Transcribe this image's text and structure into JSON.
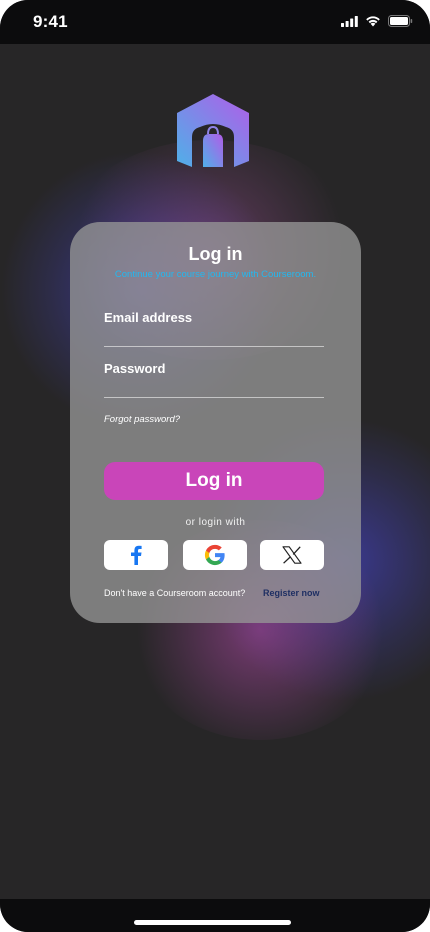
{
  "status_bar": {
    "time": "9:41",
    "icons": [
      "signal-icon",
      "wifi-icon",
      "battery-icon"
    ]
  },
  "logo": {
    "icon": "courseroom-logo-icon",
    "colors": [
      "#4fb0e8",
      "#b15de8"
    ]
  },
  "login_card": {
    "title": "Log in",
    "subtitle": "Continue your course journey with Courseroom.",
    "email_placeholder": "Email address",
    "password_placeholder": "Password",
    "forgot_password": "Forgot password?",
    "login_button": "Log in",
    "or_login_with": "or login with",
    "social_buttons": [
      {
        "name": "facebook",
        "icon": "facebook-icon"
      },
      {
        "name": "google",
        "icon": "google-icon"
      },
      {
        "name": "x",
        "icon": "x-icon"
      }
    ],
    "no_account_text": "Don't have a Courseroom account?",
    "register_link": "Register now"
  },
  "colors": {
    "background": "#272627",
    "accent": "#c945b9",
    "subtitle": "#22b8f0",
    "register_link": "#1e2f63"
  }
}
